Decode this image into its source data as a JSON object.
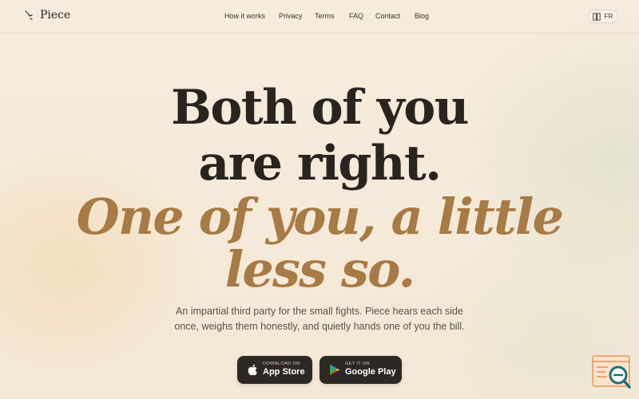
{
  "header": {
    "brand_name": "Piece",
    "nav": [
      {
        "label": "How it works"
      },
      {
        "label": "Privacy"
      },
      {
        "label": "Terms"
      },
      {
        "label": "FAQ"
      },
      {
        "label": "Contact"
      },
      {
        "label": "Blog"
      }
    ],
    "language_toggle": {
      "label": "FR",
      "icon": "book-icon"
    }
  },
  "hero": {
    "line1": "Both of you",
    "line2": "are right.",
    "line3": "One of you, a little",
    "line4": "less so.",
    "subtitle_line1": "An impartial third party for the small fights. Piece hears each side",
    "subtitle_line2": "once, weighs them honestly, and quietly hands one of you the bill."
  },
  "store_buttons": {
    "apple": {
      "small": "DOWNLOAD ON",
      "big": "App Store",
      "icon": "apple-icon"
    },
    "google": {
      "small": "GET IT ON",
      "big": "Google Play",
      "icon": "google-play-icon"
    }
  },
  "corner_badge": {
    "icon": "search-document-icon"
  },
  "colors": {
    "background": "#f5ead8",
    "heading_dark": "#2a241f",
    "accent_gold": "#a87a44",
    "button_dark": "#2d2824",
    "badge_orange": "#e8955a",
    "badge_teal": "#1f6e78"
  }
}
